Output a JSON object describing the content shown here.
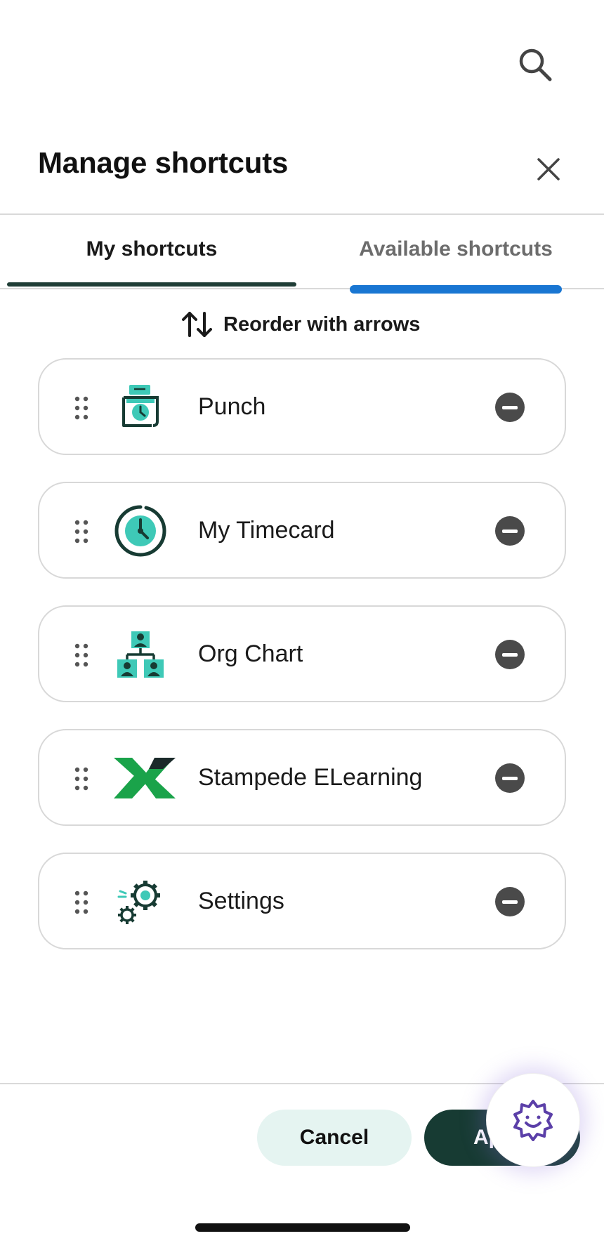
{
  "header": {
    "title": "Manage shortcuts"
  },
  "tabs": [
    {
      "label": "My shortcuts",
      "active": true
    },
    {
      "label": "Available shortcuts",
      "active": false
    }
  ],
  "reorder_hint": "Reorder with arrows",
  "shortcuts": [
    {
      "label": "Punch",
      "icon": "punch-clock-icon"
    },
    {
      "label": "My Timecard",
      "icon": "timecard-clock-icon"
    },
    {
      "label": "Org Chart",
      "icon": "org-chart-icon"
    },
    {
      "label": "Stampede ELearning",
      "icon": "stampede-x-logo-icon"
    },
    {
      "label": "Settings",
      "icon": "settings-gears-icon"
    }
  ],
  "footer": {
    "cancel_label": "Cancel",
    "apply_label": "Ap"
  },
  "colors": {
    "accent_dark": "#173b33",
    "teal": "#3ec9b7",
    "tab_blue": "#1976d2",
    "cancel_bg": "#e5f4f1",
    "assistant_purple": "#5b3fa8"
  }
}
